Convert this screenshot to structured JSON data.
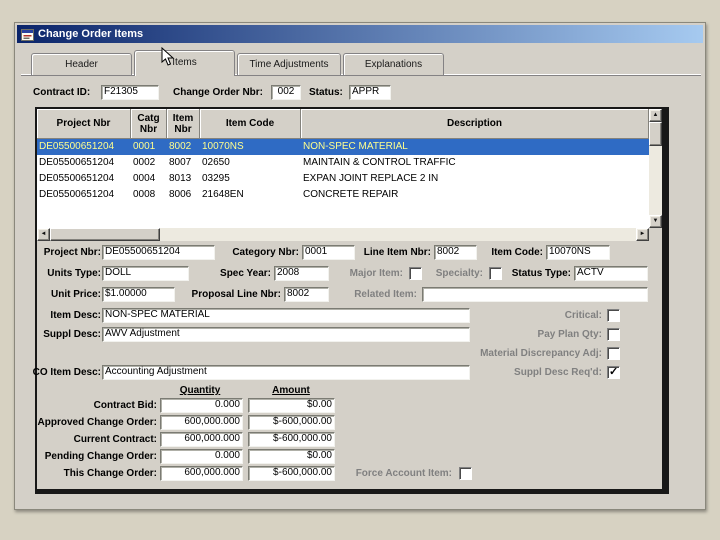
{
  "colors": {
    "page_bg": "#d7d2c2",
    "chrome": "#d4d0c8",
    "titlebar_start": "#0a246a",
    "titlebar_end": "#a6caf0",
    "selection_bg": "#2f6bc4",
    "selection_text": "#ffff8e",
    "disabled_label": "#808080"
  },
  "window": {
    "title": "Change Order Items"
  },
  "tabs": {
    "header": "Header",
    "items": "Items",
    "time_adjustments": "Time Adjustments",
    "explanations": "Explanations"
  },
  "header_bar": {
    "contract_id_label": "Contract ID:",
    "contract_id_value": "F21305",
    "change_order_label": "Change Order Nbr:",
    "change_order_value": "002",
    "status_label": "Status:",
    "status_value": "APPR"
  },
  "grid": {
    "headers": {
      "project_nbr": "Project Nbr",
      "catg_nbr": "Catg Nbr",
      "item_nbr": "Item Nbr",
      "item_code": "Item Code",
      "description": "Description"
    },
    "rows": [
      [
        "DE05500651204",
        "0001",
        "8002",
        "10070NS",
        "NON-SPEC MATERIAL"
      ],
      [
        "DE05500651204",
        "0002",
        "8007",
        "02650",
        "MAINTAIN & CONTROL TRAFFIC"
      ],
      [
        "DE05500651204",
        "0004",
        "8013",
        "03295",
        "EXPAN JOINT REPLACE 2 IN"
      ],
      [
        "DE05500651204",
        "0008",
        "8006",
        "21648EN",
        "CONCRETE REPAIR"
      ]
    ]
  },
  "icons": {
    "up": "▲",
    "down": "▼",
    "left": "◄",
    "right": "►"
  },
  "detail": {
    "project_nbr_label": "Project Nbr:",
    "project_nbr": "DE05500651204",
    "category_nbr_label": "Category Nbr:",
    "category_nbr": "0001",
    "line_item_nbr_label": "Line Item Nbr:",
    "line_item_nbr": "8002",
    "item_code_label": "Item Code:",
    "item_code": "10070NS",
    "units_type_label": "Units Type:",
    "units_type": "DOLL",
    "spec_year_label": "Spec Year:",
    "spec_year": "2008",
    "major_item_label": "Major Item:",
    "specialty_label": "Specialty:",
    "status_type_label": "Status Type:",
    "status_type": "ACTV",
    "unit_price_label": "Unit Price:",
    "unit_price": "$1.00000",
    "proposal_line_nbr_label": "Proposal Line Nbr:",
    "proposal_line_nbr": "8002",
    "related_item_label": "Related Item:",
    "related_item": "",
    "item_desc_label": "Item Desc:",
    "item_desc": "NON-SPEC MATERIAL",
    "suppl_desc_label": "Suppl Desc:",
    "suppl_desc": "AWV Adjustment",
    "co_item_desc_label": "CO Item Desc:",
    "co_item_desc": "Accounting Adjustment",
    "critical_label": "Critical:",
    "pay_plan_qty_label": "Pay Plan Qty:",
    "material_discrepancy_label": "Material Discrepancy Adj:",
    "suppl_desc_reqd_label": "Suppl Desc Req'd:",
    "force_account_label": "Force Account Item:"
  },
  "checkboxes": {
    "major_item": false,
    "specialty": false,
    "critical": false,
    "pay_plan_qty": false,
    "material_discrepancy": false,
    "suppl_desc_reqd": true,
    "force_account": false
  },
  "amounts": {
    "quantity_header": "Quantity",
    "amount_header": "Amount",
    "rows": [
      {
        "label": "Contract Bid:",
        "quantity": "0.000",
        "amount": "$0.00"
      },
      {
        "label": "Approved Change Order:",
        "quantity": "600,000.000",
        "amount": "$-600,000.00"
      },
      {
        "label": "Current Contract:",
        "quantity": "600,000.000",
        "amount": "$-600,000.00"
      },
      {
        "label": "Pending Change Order:",
        "quantity": "0.000",
        "amount": "$0.00"
      },
      {
        "label": "This Change Order:",
        "quantity": "600,000.000",
        "amount": "$-600,000.00"
      }
    ]
  }
}
